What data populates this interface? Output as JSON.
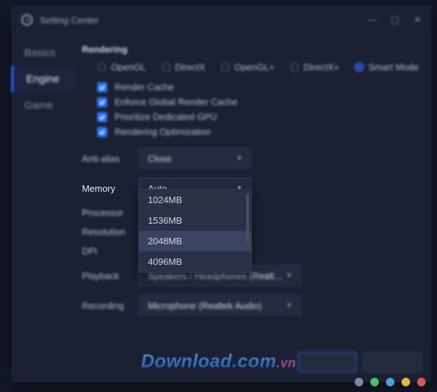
{
  "window": {
    "title": "Setting Center"
  },
  "sidebar": {
    "tabs": [
      {
        "label": "Basics"
      },
      {
        "label": "Engine"
      },
      {
        "label": "Game"
      }
    ],
    "active_index": 1
  },
  "rendering": {
    "title": "Rendering",
    "modes": [
      {
        "label": "OpenGL",
        "selected": false
      },
      {
        "label": "DirectX",
        "selected": false
      },
      {
        "label": "OpenGL+",
        "selected": false
      },
      {
        "label": "DirectX+",
        "selected": false
      },
      {
        "label": "Smart Mode",
        "selected": true
      }
    ],
    "checks": [
      {
        "label": "Render Cache",
        "checked": true
      },
      {
        "label": "Enforce Global Render Cache",
        "checked": true
      },
      {
        "label": "Prioritize Dedicated GPU",
        "checked": true
      },
      {
        "label": "Rendering Optimization",
        "checked": true
      }
    ]
  },
  "fields": {
    "anti_alias": {
      "label": "Anti-alias",
      "value": "Close"
    },
    "memory": {
      "label": "Memory",
      "value": "Auto",
      "open": true,
      "options": [
        "1024MB",
        "1536MB",
        "2048MB",
        "4096MB"
      ],
      "hover_index": 2
    },
    "processor": {
      "label": "Processor"
    },
    "resolution": {
      "label": "Resolution"
    },
    "dpi": {
      "label": "DPI"
    },
    "playback": {
      "label": "Playback",
      "value": "Speakers / Headphones (Realtek Audio)"
    },
    "recording": {
      "label": "Recording",
      "value": "Microphone (Realtek Audio)"
    }
  },
  "watermark": {
    "brand": "Download",
    "tld": ".com",
    "cc": ".vn"
  },
  "dots_colors": [
    "#808a9f",
    "#47c26b",
    "#4aa0d8",
    "#e2b93f",
    "#d65a5a"
  ]
}
